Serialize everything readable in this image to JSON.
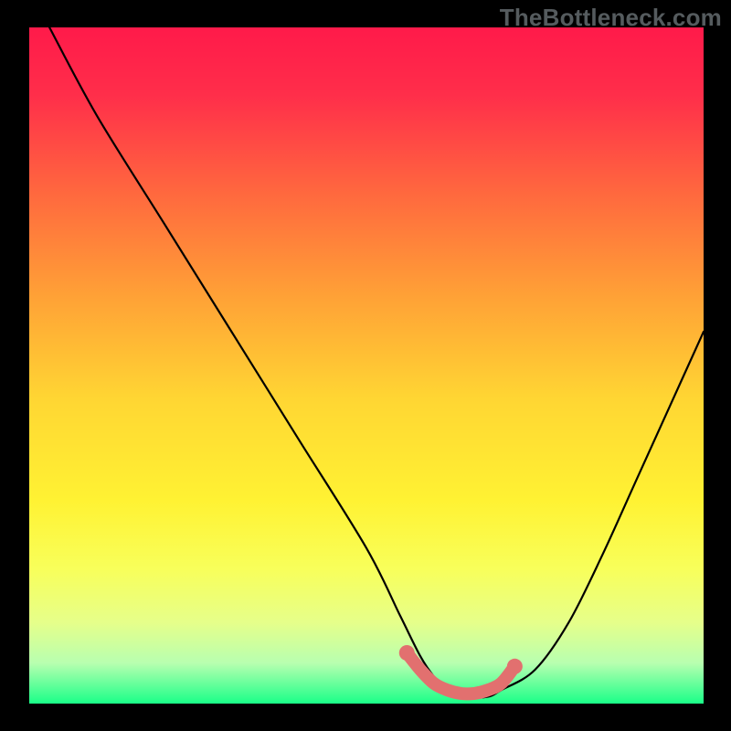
{
  "watermark": "TheBottleneck.com",
  "colors": {
    "background": "#000000",
    "gradient_stops": [
      {
        "offset": 0.0,
        "color": "#ff1a4a"
      },
      {
        "offset": 0.1,
        "color": "#ff2e4a"
      },
      {
        "offset": 0.25,
        "color": "#ff6a3e"
      },
      {
        "offset": 0.4,
        "color": "#ffa236"
      },
      {
        "offset": 0.55,
        "color": "#ffd633"
      },
      {
        "offset": 0.7,
        "color": "#fff233"
      },
      {
        "offset": 0.8,
        "color": "#f8ff5a"
      },
      {
        "offset": 0.88,
        "color": "#e6ff8a"
      },
      {
        "offset": 0.94,
        "color": "#b8ffb0"
      },
      {
        "offset": 1.0,
        "color": "#1aff88"
      }
    ],
    "curve": "#000000",
    "marker_fill": "#e2706f",
    "marker_stroke": "#e2706f"
  },
  "chart_data": {
    "type": "line",
    "title": "",
    "xlabel": "",
    "ylabel": "",
    "xlim": [
      0,
      100
    ],
    "ylim": [
      0,
      100
    ],
    "series": [
      {
        "name": "bottleneck-curve",
        "x": [
          3,
          10,
          20,
          30,
          40,
          50,
          55,
          58,
          60,
          62,
          65,
          68,
          70,
          75,
          80,
          85,
          90,
          95,
          100
        ],
        "y": [
          100,
          87,
          71,
          55,
          39,
          23,
          13,
          7,
          4,
          2,
          1,
          1,
          2,
          5,
          12,
          22,
          33,
          44,
          55
        ]
      }
    ],
    "markers": {
      "name": "highlight-band",
      "x": [
        56,
        58,
        60,
        62,
        64,
        66,
        68,
        70,
        72
      ],
      "y": [
        7.5,
        5.0,
        3.0,
        2.0,
        1.5,
        1.5,
        2.0,
        3.0,
        5.5
      ]
    }
  }
}
